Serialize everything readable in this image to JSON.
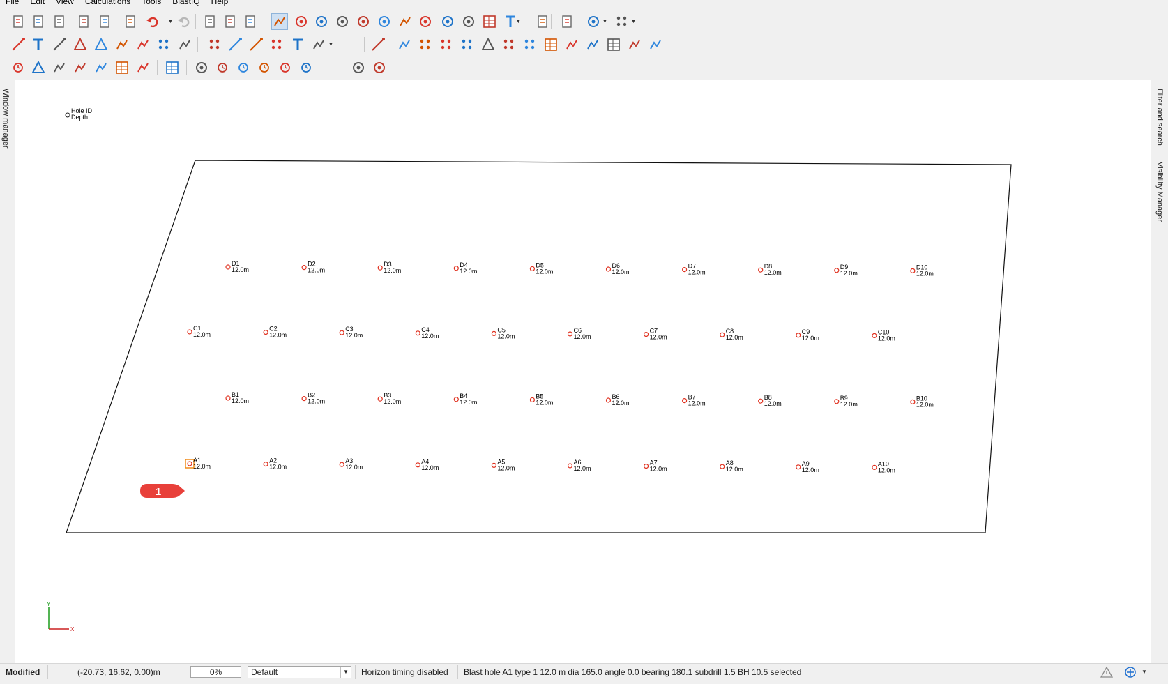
{
  "menu": [
    "File",
    "Edit",
    "View",
    "Calculations",
    "Tools",
    "BlastIQ",
    "Help"
  ],
  "side_tabs": {
    "left": "Window manager",
    "right_top": "Filter and search",
    "right_bottom": "Visibility Manager"
  },
  "legend": {
    "line1": "Hole ID",
    "line2": "Depth"
  },
  "holes": [
    {
      "id": "D1",
      "depth": "12.0m"
    },
    {
      "id": "D2",
      "depth": "12.0m"
    },
    {
      "id": "D3",
      "depth": "12.0m"
    },
    {
      "id": "D4",
      "depth": "12.0m"
    },
    {
      "id": "D5",
      "depth": "12.0m"
    },
    {
      "id": "D6",
      "depth": "12.0m"
    },
    {
      "id": "D7",
      "depth": "12.0m"
    },
    {
      "id": "D8",
      "depth": "12.0m"
    },
    {
      "id": "D9",
      "depth": "12.0m"
    },
    {
      "id": "D10",
      "depth": "12.0m"
    },
    {
      "id": "C1",
      "depth": "12.0m"
    },
    {
      "id": "C2",
      "depth": "12.0m"
    },
    {
      "id": "C3",
      "depth": "12.0m"
    },
    {
      "id": "C4",
      "depth": "12.0m"
    },
    {
      "id": "C5",
      "depth": "12.0m"
    },
    {
      "id": "C6",
      "depth": "12.0m"
    },
    {
      "id": "C7",
      "depth": "12.0m"
    },
    {
      "id": "C8",
      "depth": "12.0m"
    },
    {
      "id": "C9",
      "depth": "12.0m"
    },
    {
      "id": "C10",
      "depth": "12.0m"
    },
    {
      "id": "B1",
      "depth": "12.0m"
    },
    {
      "id": "B2",
      "depth": "12.0m"
    },
    {
      "id": "B3",
      "depth": "12.0m"
    },
    {
      "id": "B4",
      "depth": "12.0m"
    },
    {
      "id": "B5",
      "depth": "12.0m"
    },
    {
      "id": "B6",
      "depth": "12.0m"
    },
    {
      "id": "B7",
      "depth": "12.0m"
    },
    {
      "id": "B8",
      "depth": "12.0m"
    },
    {
      "id": "B9",
      "depth": "12.0m"
    },
    {
      "id": "B10",
      "depth": "12.0m"
    },
    {
      "id": "A1",
      "depth": "12.0m",
      "selected": true
    },
    {
      "id": "A2",
      "depth": "12.0m"
    },
    {
      "id": "A3",
      "depth": "12.0m"
    },
    {
      "id": "A4",
      "depth": "12.0m"
    },
    {
      "id": "A5",
      "depth": "12.0m"
    },
    {
      "id": "A6",
      "depth": "12.0m"
    },
    {
      "id": "A7",
      "depth": "12.0m"
    },
    {
      "id": "A8",
      "depth": "12.0m"
    },
    {
      "id": "A9",
      "depth": "12.0m"
    },
    {
      "id": "A10",
      "depth": "12.0m"
    }
  ],
  "callout": {
    "label": "1",
    "color": "#e8403a"
  },
  "axes": {
    "x": "X",
    "y": "Y"
  },
  "colors": {
    "hole": "#e0301e",
    "selection": "#f08c1a",
    "axis_x": "#cc2020",
    "axis_y": "#1a9a1a"
  },
  "toolbar_icons": {
    "row1": [
      "new-file",
      "open-folder",
      "save",
      "print",
      "print-preview",
      "delete",
      "undo",
      "redo",
      "cut",
      "copy",
      "paste",
      "select-arrow",
      "zoom-extents",
      "zoom-in",
      "zoom-out",
      "zoom-previous",
      "rotate-view",
      "pan-hand",
      "zoom-window",
      "north-view",
      "3d-view",
      "layers",
      "text-size",
      "lock",
      "filter",
      "grid-snap",
      "grid-display"
    ],
    "row2": [
      "add-point",
      "add-text",
      "draw-line",
      "draw-polygon",
      "draw-triangle",
      "measure",
      "measure-bearing",
      "add-hole",
      "surface-point",
      "pattern-100",
      "line-tool",
      "dimension-tool",
      "hole-number",
      "sum-tool",
      "drill-rig",
      "draw-segment",
      "design-arc",
      "hole-row",
      "hole-grid",
      "hole-pattern",
      "ramp",
      "hole-array",
      "hole-check",
      "boundary-box",
      "ring-design",
      "charge",
      "section",
      "profile",
      "hexagon"
    ],
    "row3": [
      "timing-line",
      "triangle-warning",
      "contour",
      "delay-path",
      "wave-chart",
      "report",
      "toggle-edit",
      "table",
      "level-1",
      "timing-clock",
      "timing-multi",
      "timing-arc",
      "timing-subtract",
      "timing-cycle",
      "download-cloud",
      "upload-cloud"
    ]
  },
  "status": {
    "modified": "Modified",
    "coords": "(-20.73, 16.62, 0.00)m",
    "progress": "0%",
    "layer": "Default",
    "horizon": "Horizon timing disabled",
    "selection": "Blast hole A1 type 1 12.0 m dia 165.0 angle 0.0 bearing 180.1 subdrill 1.5 BH 10.5 selected"
  }
}
